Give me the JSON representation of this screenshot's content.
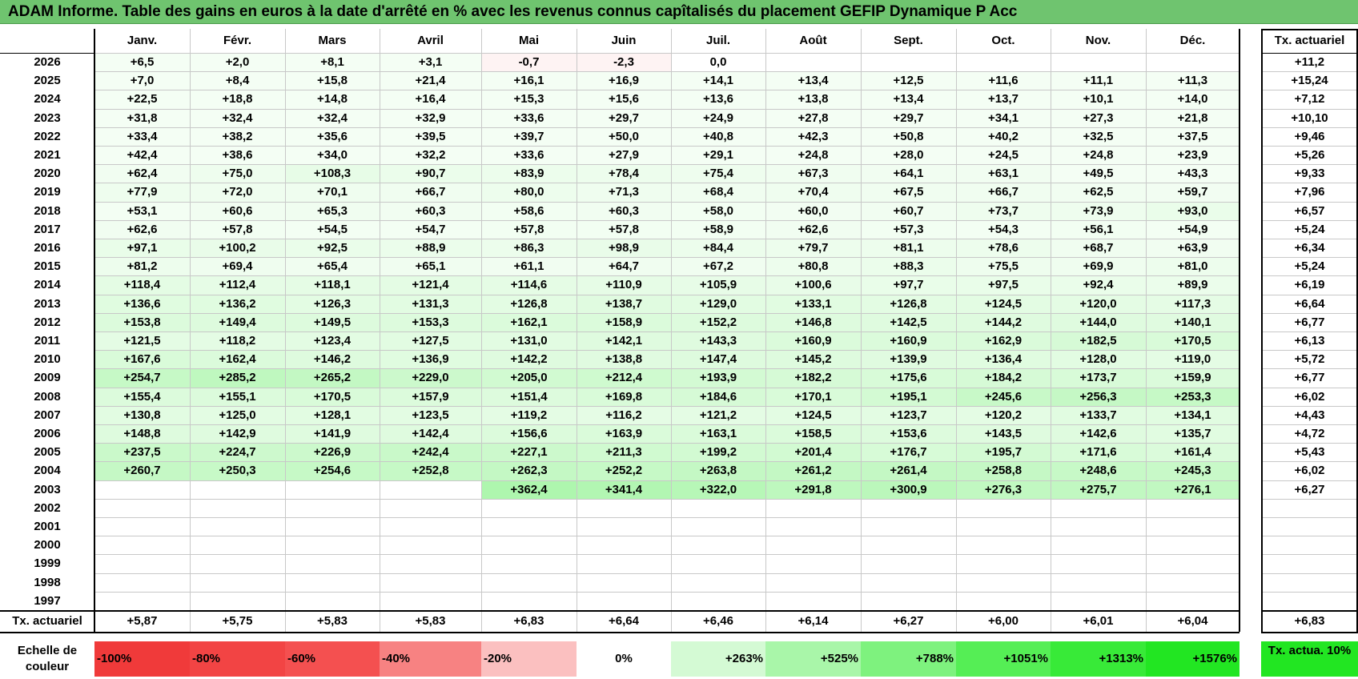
{
  "title": "ADAM Informe. Table des gains en euros à la date d'arrêté en % avec les revenus connus capîtalisés du placement GEFIP Dynamique P Acc",
  "months": [
    "Janv.",
    "Févr.",
    "Mars",
    "Avril",
    "Mai",
    "Juin",
    "Juil.",
    "Août",
    "Sept.",
    "Oct.",
    "Nov.",
    "Déc."
  ],
  "annual_header": "Tx. actuariel",
  "rows": [
    {
      "year": "2026",
      "values": [
        "+6,5",
        "+2,0",
        "+8,1",
        "+3,1",
        "-0,7",
        "-2,3",
        "0,0",
        "",
        "",
        "",
        "",
        ""
      ],
      "rate": "+11,2"
    },
    {
      "year": "2025",
      "values": [
        "+7,0",
        "+8,4",
        "+15,8",
        "+21,4",
        "+16,1",
        "+16,9",
        "+14,1",
        "+13,4",
        "+12,5",
        "+11,6",
        "+11,1",
        "+11,3"
      ],
      "rate": "+15,24"
    },
    {
      "year": "2024",
      "values": [
        "+22,5",
        "+18,8",
        "+14,8",
        "+16,4",
        "+15,3",
        "+15,6",
        "+13,6",
        "+13,8",
        "+13,4",
        "+13,7",
        "+10,1",
        "+14,0"
      ],
      "rate": "+7,12"
    },
    {
      "year": "2023",
      "values": [
        "+31,8",
        "+32,4",
        "+32,4",
        "+32,9",
        "+33,6",
        "+29,7",
        "+24,9",
        "+27,8",
        "+29,7",
        "+34,1",
        "+27,3",
        "+21,8"
      ],
      "rate": "+10,10"
    },
    {
      "year": "2022",
      "values": [
        "+33,4",
        "+38,2",
        "+35,6",
        "+39,5",
        "+39,7",
        "+50,0",
        "+40,8",
        "+42,3",
        "+50,8",
        "+40,2",
        "+32,5",
        "+37,5"
      ],
      "rate": "+9,46"
    },
    {
      "year": "2021",
      "values": [
        "+42,4",
        "+38,6",
        "+34,0",
        "+32,2",
        "+33,6",
        "+27,9",
        "+29,1",
        "+24,8",
        "+28,0",
        "+24,5",
        "+24,8",
        "+23,9"
      ],
      "rate": "+5,26"
    },
    {
      "year": "2020",
      "values": [
        "+62,4",
        "+75,0",
        "+108,3",
        "+90,7",
        "+83,9",
        "+78,4",
        "+75,4",
        "+67,3",
        "+64,1",
        "+63,1",
        "+49,5",
        "+43,3"
      ],
      "rate": "+9,33"
    },
    {
      "year": "2019",
      "values": [
        "+77,9",
        "+72,0",
        "+70,1",
        "+66,7",
        "+80,0",
        "+71,3",
        "+68,4",
        "+70,4",
        "+67,5",
        "+66,7",
        "+62,5",
        "+59,7"
      ],
      "rate": "+7,96"
    },
    {
      "year": "2018",
      "values": [
        "+53,1",
        "+60,6",
        "+65,3",
        "+60,3",
        "+58,6",
        "+60,3",
        "+58,0",
        "+60,0",
        "+60,7",
        "+73,7",
        "+73,9",
        "+93,0"
      ],
      "rate": "+6,57"
    },
    {
      "year": "2017",
      "values": [
        "+62,6",
        "+57,8",
        "+54,5",
        "+54,7",
        "+57,8",
        "+57,8",
        "+58,9",
        "+62,6",
        "+57,3",
        "+54,3",
        "+56,1",
        "+54,9"
      ],
      "rate": "+5,24"
    },
    {
      "year": "2016",
      "values": [
        "+97,1",
        "+100,2",
        "+92,5",
        "+88,9",
        "+86,3",
        "+98,9",
        "+84,4",
        "+79,7",
        "+81,1",
        "+78,6",
        "+68,7",
        "+63,9"
      ],
      "rate": "+6,34"
    },
    {
      "year": "2015",
      "values": [
        "+81,2",
        "+69,4",
        "+65,4",
        "+65,1",
        "+61,1",
        "+64,7",
        "+67,2",
        "+80,8",
        "+88,3",
        "+75,5",
        "+69,9",
        "+81,0"
      ],
      "rate": "+5,24"
    },
    {
      "year": "2014",
      "values": [
        "+118,4",
        "+112,4",
        "+118,1",
        "+121,4",
        "+114,6",
        "+110,9",
        "+105,9",
        "+100,6",
        "+97,7",
        "+97,5",
        "+92,4",
        "+89,9"
      ],
      "rate": "+6,19"
    },
    {
      "year": "2013",
      "values": [
        "+136,6",
        "+136,2",
        "+126,3",
        "+131,3",
        "+126,8",
        "+138,7",
        "+129,0",
        "+133,1",
        "+126,8",
        "+124,5",
        "+120,0",
        "+117,3"
      ],
      "rate": "+6,64"
    },
    {
      "year": "2012",
      "values": [
        "+153,8",
        "+149,4",
        "+149,5",
        "+153,3",
        "+162,1",
        "+158,9",
        "+152,2",
        "+146,8",
        "+142,5",
        "+144,2",
        "+144,0",
        "+140,1"
      ],
      "rate": "+6,77"
    },
    {
      "year": "2011",
      "values": [
        "+121,5",
        "+118,2",
        "+123,4",
        "+127,5",
        "+131,0",
        "+142,1",
        "+143,3",
        "+160,9",
        "+160,9",
        "+162,9",
        "+182,5",
        "+170,5"
      ],
      "rate": "+6,13"
    },
    {
      "year": "2010",
      "values": [
        "+167,6",
        "+162,4",
        "+146,2",
        "+136,9",
        "+142,2",
        "+138,8",
        "+147,4",
        "+145,2",
        "+139,9",
        "+136,4",
        "+128,0",
        "+119,0"
      ],
      "rate": "+5,72"
    },
    {
      "year": "2009",
      "values": [
        "+254,7",
        "+285,2",
        "+265,2",
        "+229,0",
        "+205,0",
        "+212,4",
        "+193,9",
        "+182,2",
        "+175,6",
        "+184,2",
        "+173,7",
        "+159,9"
      ],
      "rate": "+6,77"
    },
    {
      "year": "2008",
      "values": [
        "+155,4",
        "+155,1",
        "+170,5",
        "+157,9",
        "+151,4",
        "+169,8",
        "+184,6",
        "+170,1",
        "+195,1",
        "+245,6",
        "+256,3",
        "+253,3"
      ],
      "rate": "+6,02"
    },
    {
      "year": "2007",
      "values": [
        "+130,8",
        "+125,0",
        "+128,1",
        "+123,5",
        "+119,2",
        "+116,2",
        "+121,2",
        "+124,5",
        "+123,7",
        "+120,2",
        "+133,7",
        "+134,1"
      ],
      "rate": "+4,43"
    },
    {
      "year": "2006",
      "values": [
        "+148,8",
        "+142,9",
        "+141,9",
        "+142,4",
        "+156,6",
        "+163,9",
        "+163,1",
        "+158,5",
        "+153,6",
        "+143,5",
        "+142,6",
        "+135,7"
      ],
      "rate": "+4,72"
    },
    {
      "year": "2005",
      "values": [
        "+237,5",
        "+224,7",
        "+226,9",
        "+242,4",
        "+227,1",
        "+211,3",
        "+199,2",
        "+201,4",
        "+176,7",
        "+195,7",
        "+171,6",
        "+161,4"
      ],
      "rate": "+5,43"
    },
    {
      "year": "2004",
      "values": [
        "+260,7",
        "+250,3",
        "+254,6",
        "+252,8",
        "+262,3",
        "+252,2",
        "+263,8",
        "+261,2",
        "+261,4",
        "+258,8",
        "+248,6",
        "+245,3"
      ],
      "rate": "+6,02"
    },
    {
      "year": "2003",
      "values": [
        "",
        "",
        "",
        "",
        "+362,4",
        "+341,4",
        "+322,0",
        "+291,8",
        "+300,9",
        "+276,3",
        "+275,7",
        "+276,1"
      ],
      "rate": "+6,27"
    },
    {
      "year": "2002",
      "values": [
        "",
        "",
        "",
        "",
        "",
        "",
        "",
        "",
        "",
        "",
        "",
        ""
      ],
      "rate": ""
    },
    {
      "year": "2001",
      "values": [
        "",
        "",
        "",
        "",
        "",
        "",
        "",
        "",
        "",
        "",
        "",
        ""
      ],
      "rate": ""
    },
    {
      "year": "2000",
      "values": [
        "",
        "",
        "",
        "",
        "",
        "",
        "",
        "",
        "",
        "",
        "",
        ""
      ],
      "rate": ""
    },
    {
      "year": "1999",
      "values": [
        "",
        "",
        "",
        "",
        "",
        "",
        "",
        "",
        "",
        "",
        "",
        ""
      ],
      "rate": ""
    },
    {
      "year": "1998",
      "values": [
        "",
        "",
        "",
        "",
        "",
        "",
        "",
        "",
        "",
        "",
        "",
        ""
      ],
      "rate": ""
    },
    {
      "year": "1997",
      "values": [
        "",
        "",
        "",
        "",
        "",
        "",
        "",
        "",
        "",
        "",
        "",
        ""
      ],
      "rate": ""
    }
  ],
  "footer": {
    "label": "Tx. actuariel",
    "values": [
      "+5,87",
      "+5,75",
      "+5,83",
      "+5,83",
      "+6,83",
      "+6,64",
      "+6,46",
      "+6,14",
      "+6,27",
      "+6,00",
      "+6,01",
      "+6,04"
    ],
    "rate": "+6,83"
  },
  "scale": {
    "label": "Echelle de couleur",
    "items": [
      {
        "text": "-100%",
        "color": "#f03a3a",
        "align": "left"
      },
      {
        "text": "-80%",
        "color": "#f24444",
        "align": "left"
      },
      {
        "text": "-60%",
        "color": "#f45050",
        "align": "left"
      },
      {
        "text": "-40%",
        "color": "#f78282",
        "align": "left"
      },
      {
        "text": "-20%",
        "color": "#fbc0c0",
        "align": "left"
      },
      {
        "text": "0%",
        "color": "#ffffff",
        "align": "center"
      },
      {
        "text": "+263%",
        "color": "#d4fad4",
        "align": "right"
      },
      {
        "text": "+525%",
        "color": "#a9f6a9",
        "align": "right"
      },
      {
        "text": "+788%",
        "color": "#7ef27e",
        "align": "right"
      },
      {
        "text": "+1051%",
        "color": "#55ee55",
        "align": "right"
      },
      {
        "text": "+1313%",
        "color": "#38ea38",
        "align": "right"
      },
      {
        "text": "+1576%",
        "color": "#22e622",
        "align": "right"
      }
    ],
    "right_label": "Tx. actua. 10%",
    "right_color": "#22e622"
  },
  "colors": {
    "title_bg": "#6fc46f",
    "green_max": "#22e622",
    "red_max": "#f03a3a"
  }
}
